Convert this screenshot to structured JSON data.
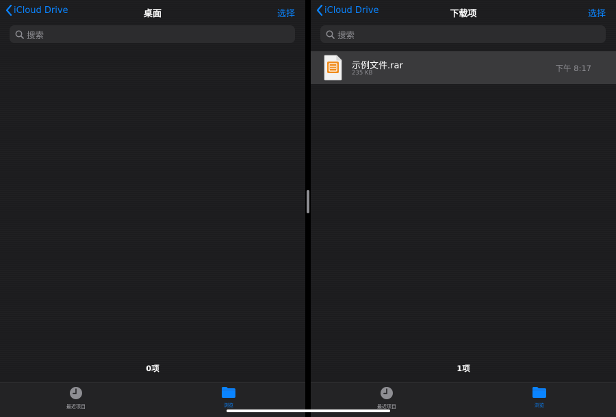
{
  "colors": {
    "accent": "#0a84ff",
    "background": "#1c1c1e",
    "secondary_text": "#8e8e93"
  },
  "left_pane": {
    "back_label": "iCloud Drive",
    "title": "桌面",
    "select_label": "选择",
    "search_placeholder": "搜索",
    "item_count": "0项",
    "tabs": {
      "recent_label": "最近项目",
      "browse_label": "浏览"
    }
  },
  "right_pane": {
    "back_label": "iCloud Drive",
    "title": "下载项",
    "select_label": "选择",
    "search_placeholder": "搜索",
    "files": [
      {
        "name": "示例文件.rar",
        "size": "235 KB",
        "time": "下午 8:17",
        "icon": "rar-archive-icon"
      }
    ],
    "item_count": "1项",
    "tabs": {
      "recent_label": "最近项目",
      "browse_label": "浏览"
    }
  }
}
